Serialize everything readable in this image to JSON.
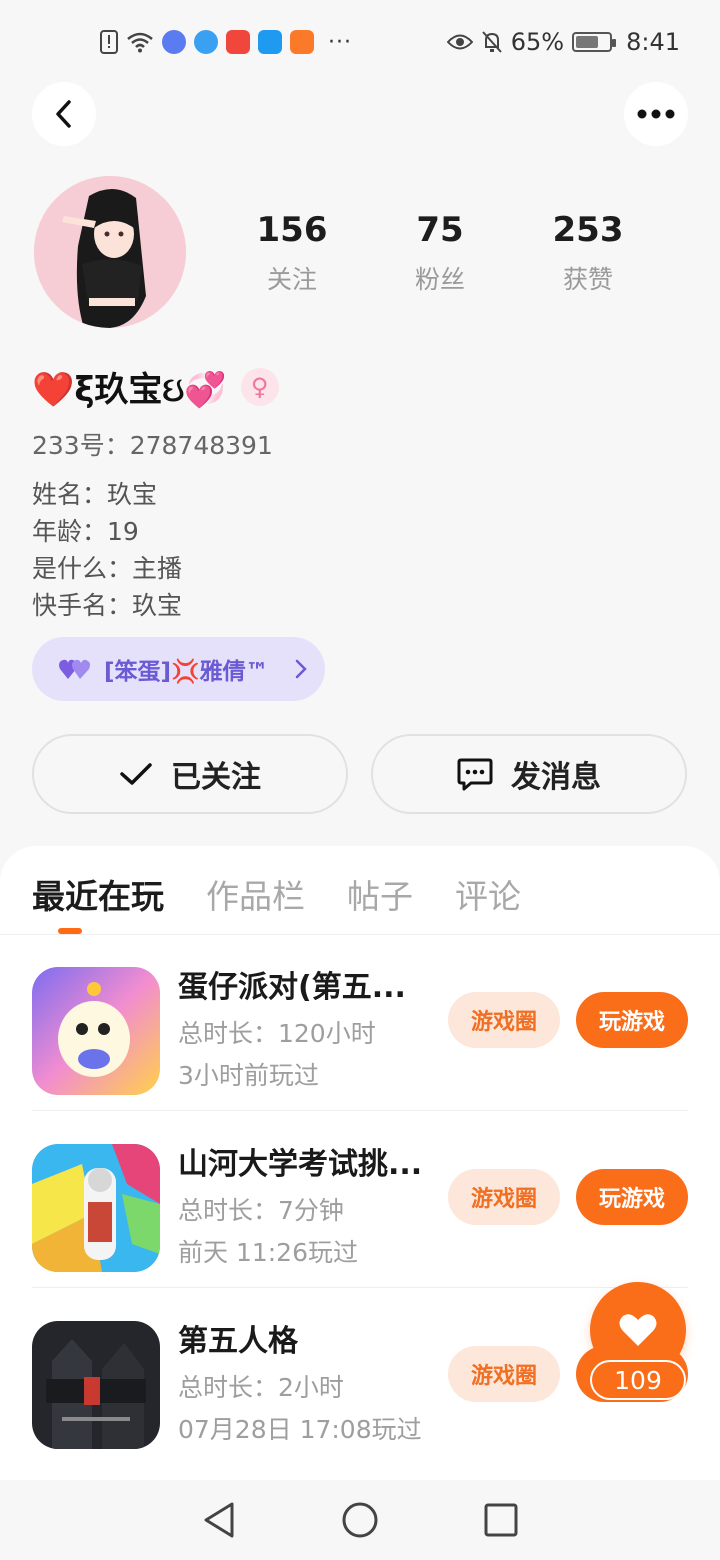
{
  "status_bar": {
    "battery": "65%",
    "time": "8:41"
  },
  "profile": {
    "stats": [
      {
        "value": "156",
        "label": "关注"
      },
      {
        "value": "75",
        "label": "粉丝"
      },
      {
        "value": "253",
        "label": "获赞"
      }
    ],
    "nickname": "❤️ξ玖宝ઇ💞",
    "gender_symbol": "♀",
    "uid": "233号：278748391",
    "bio": [
      "姓名：玖宝",
      "年龄：19",
      "是什么：主播",
      "快手名：玖宝"
    ],
    "fan_group": "[笨蛋]💢雅倩™"
  },
  "actions": {
    "follow_label": "已关注",
    "message_label": "发消息"
  },
  "tabs": [
    "最近在玩",
    "作品栏",
    "帖子",
    "评论"
  ],
  "games": [
    {
      "title": "蛋仔派对(第五...",
      "duration": "总时长：120小时",
      "last_played": "3小时前玩过",
      "circle_label": "游戏圈",
      "play_label": "玩游戏"
    },
    {
      "title": "山河大学考试挑...",
      "duration": "总时长：7分钟",
      "last_played": "前天 11:26玩过",
      "circle_label": "游戏圈",
      "play_label": "玩游戏"
    },
    {
      "title": "第五人格",
      "duration": "总时长：2小时",
      "last_played": "07月28日 17:08玩过",
      "circle_label": "游戏圈",
      "play_label": "玩游戏"
    }
  ],
  "float_like": {
    "count": "109"
  },
  "colors": {
    "accent": "#fa6d19",
    "accent_light": "#fde7da",
    "badge_purple": "#6a5ad4",
    "badge_bg": "#e5e1fb"
  },
  "icons": [
    "back-arrow-icon",
    "more-dots-icon",
    "check-icon",
    "chat-bubble-icon",
    "heart-icon",
    "gender-female-icon",
    "chevron-right-icon"
  ]
}
